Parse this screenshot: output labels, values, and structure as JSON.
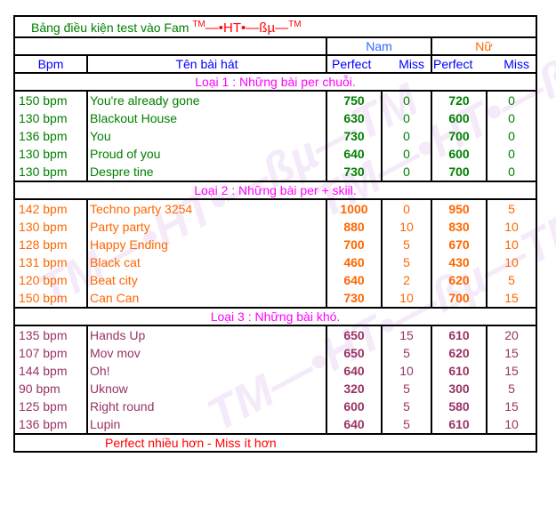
{
  "title": {
    "text": "Bảng điều kiện test vào Fam",
    "signature_tm_left": "TM",
    "signature": "—•HT•—ßµ—",
    "signature_tm_right": "TM"
  },
  "group_headers": {
    "nam": "Nam",
    "nu": "Nữ"
  },
  "column_headers": {
    "bpm": "Bpm",
    "song": "Tên bài hát",
    "perfect": "Perfect",
    "miss": "Miss"
  },
  "colors": {
    "title": "#008000",
    "nam": "#3366ff",
    "nu": "#ff6600",
    "category": "#ff00ff",
    "cat1": "#008000",
    "cat2": "#ff6600",
    "cat3": "#993366",
    "footer": "#ff0000"
  },
  "categories": [
    {
      "label": "Loại 1 : Những bài per chuỗi.",
      "rows": [
        {
          "bpm": "150 bpm",
          "song": "You're already gone",
          "nam_perfect": "750",
          "nam_miss": "0",
          "nu_perfect": "720",
          "nu_miss": "0"
        },
        {
          "bpm": "130 bpm",
          "song": "Blackout House",
          "nam_perfect": "630",
          "nam_miss": "0",
          "nu_perfect": "600",
          "nu_miss": "0"
        },
        {
          "bpm": "136 bpm",
          "song": "You",
          "nam_perfect": "730",
          "nam_miss": "0",
          "nu_perfect": "700",
          "nu_miss": "0"
        },
        {
          "bpm": "130 bpm",
          "song": "Proud of you",
          "nam_perfect": "640",
          "nam_miss": "0",
          "nu_perfect": "600",
          "nu_miss": "0"
        },
        {
          "bpm": "130 bpm",
          "song": "Despre tine",
          "nam_perfect": "730",
          "nam_miss": "0",
          "nu_perfect": "700",
          "nu_miss": "0"
        }
      ]
    },
    {
      "label": "Loại 2 : Những bài per + skiil.",
      "rows": [
        {
          "bpm": "142 bpm",
          "song": "Techno party 3254",
          "nam_perfect": "1000",
          "nam_miss": "0",
          "nu_perfect": "950",
          "nu_miss": "5"
        },
        {
          "bpm": "130 bpm",
          "song": "Party party",
          "nam_perfect": "880",
          "nam_miss": "10",
          "nu_perfect": "830",
          "nu_miss": "10"
        },
        {
          "bpm": "128 bpm",
          "song": "Happy Ending",
          "nam_perfect": "700",
          "nam_miss": "5",
          "nu_perfect": "670",
          "nu_miss": "10"
        },
        {
          "bpm": "131 bpm",
          "song": "Black cat",
          "nam_perfect": "460",
          "nam_miss": "5",
          "nu_perfect": "430",
          "nu_miss": "10"
        },
        {
          "bpm": "120 bpm",
          "song": "Beat city",
          "nam_perfect": "640",
          "nam_miss": "2",
          "nu_perfect": "620",
          "nu_miss": "5"
        },
        {
          "bpm": "150 bpm",
          "song": "Can Can",
          "nam_perfect": "730",
          "nam_miss": "10",
          "nu_perfect": "700",
          "nu_miss": "15"
        }
      ]
    },
    {
      "label": "Loại 3 : Những bài khó.",
      "rows": [
        {
          "bpm": "135 bpm",
          "song": "Hands Up",
          "nam_perfect": "650",
          "nam_miss": "15",
          "nu_perfect": "610",
          "nu_miss": "20"
        },
        {
          "bpm": "107 bpm",
          "song": "Mov mov",
          "nam_perfect": "650",
          "nam_miss": "5",
          "nu_perfect": "620",
          "nu_miss": "15"
        },
        {
          "bpm": "144 bpm",
          "song": "Oh!",
          "nam_perfect": "640",
          "nam_miss": "10",
          "nu_perfect": "610",
          "nu_miss": "15"
        },
        {
          "bpm": "90 bpm",
          "song": "Uknow",
          "nam_perfect": "320",
          "nam_miss": "5",
          "nu_perfect": "300",
          "nu_miss": "5"
        },
        {
          "bpm": "125 bpm",
          "song": "Right round",
          "nam_perfect": "600",
          "nam_miss": "5",
          "nu_perfect": "580",
          "nu_miss": "15"
        },
        {
          "bpm": "136 bpm",
          "song": "Lupin",
          "nam_perfect": "640",
          "nam_miss": "5",
          "nu_perfect": "610",
          "nu_miss": "10"
        }
      ]
    }
  ],
  "footer": "Perfect nhiều hơn - Miss ít hơn",
  "watermark": "TM—•HT•—ßµ—TM"
}
